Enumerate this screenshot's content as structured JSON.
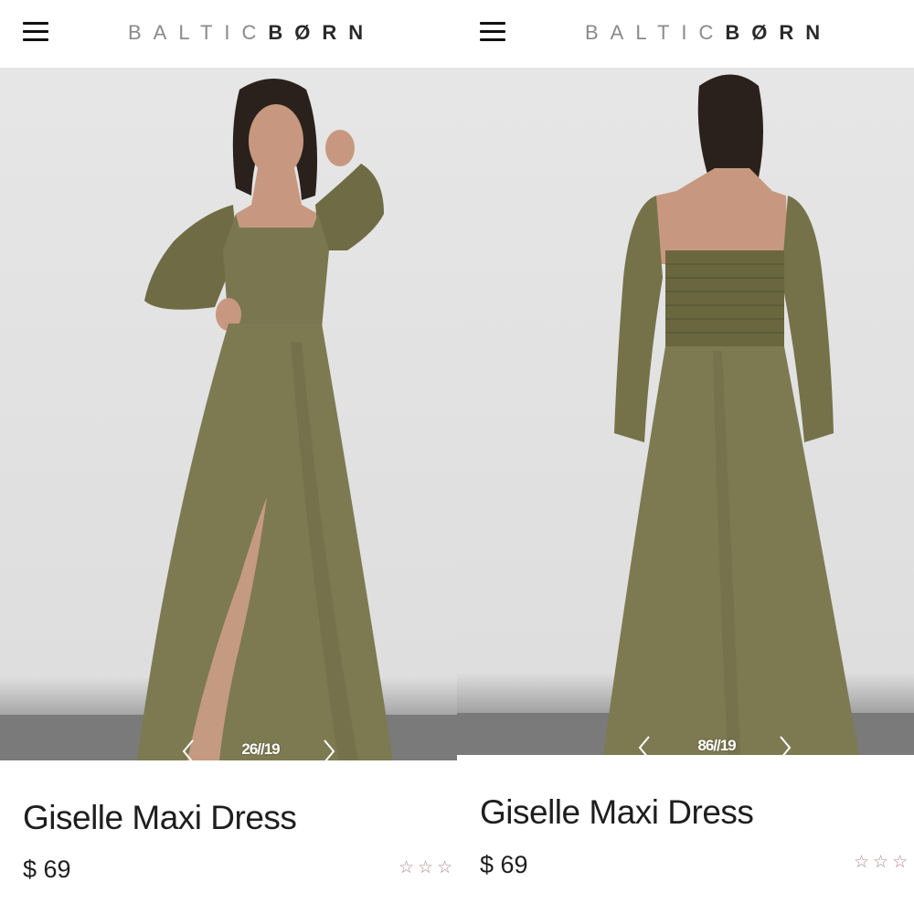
{
  "brand": {
    "logo_light": "BALTIC",
    "logo_dark": "BØRN"
  },
  "colors": {
    "dress_olive": "#7d7a52",
    "background": "#ffffff",
    "star_outline": "#b28a8a"
  },
  "icons": {
    "menu": "hamburger-icon",
    "prev": "chevron-left-icon",
    "next": "chevron-right-icon",
    "rating": "star-outline-icon"
  },
  "panels": [
    {
      "product": {
        "title": "Giselle Maxi Dress",
        "price": "$ 69",
        "rating_stars": "☆☆☆"
      },
      "carousel": {
        "counter": "26//19"
      }
    },
    {
      "product": {
        "title": "Giselle Maxi Dress",
        "price": "$ 69",
        "rating_stars": "☆☆☆"
      },
      "carousel": {
        "counter": "86//19"
      }
    }
  ]
}
